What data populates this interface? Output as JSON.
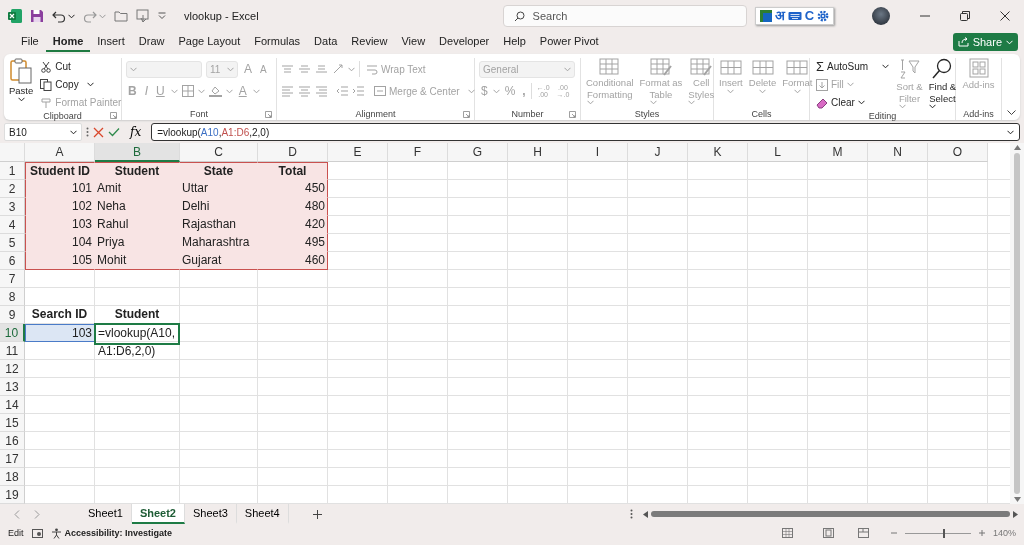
{
  "title_bar": {
    "title": "vlookup  -  Excel",
    "search_placeholder": "Search",
    "language_bar": [
      "अ",
      "C"
    ]
  },
  "menu_tabs": [
    {
      "label": "File",
      "selected": false
    },
    {
      "label": "Home",
      "selected": true
    },
    {
      "label": "Insert",
      "selected": false
    },
    {
      "label": "Draw",
      "selected": false
    },
    {
      "label": "Page Layout",
      "selected": false
    },
    {
      "label": "Formulas",
      "selected": false
    },
    {
      "label": "Data",
      "selected": false
    },
    {
      "label": "Review",
      "selected": false
    },
    {
      "label": "View",
      "selected": false
    },
    {
      "label": "Developer",
      "selected": false
    },
    {
      "label": "Help",
      "selected": false
    },
    {
      "label": "Power Pivot",
      "selected": false
    }
  ],
  "share_button": {
    "label": "Share"
  },
  "ribbon": {
    "clipboard": {
      "label": "Clipboard",
      "paste": {
        "label": "Paste",
        "disabled": false
      },
      "cut": {
        "label": "Cut",
        "disabled": false
      },
      "copy": {
        "label": "Copy",
        "disabled": false
      },
      "format_painter": {
        "label": "Format Painter",
        "disabled": true
      }
    },
    "font": {
      "label": "Font",
      "disabled": true,
      "font_size": "11",
      "grow_font": "A",
      "shrink_font": "A",
      "bold": "B",
      "italic": "I",
      "underline": "U",
      "font_color": "A"
    },
    "alignment": {
      "label": "Alignment",
      "disabled": true,
      "wrap_text": "Wrap Text",
      "merge_center": "Merge & Center"
    },
    "number": {
      "label": "Number",
      "disabled": true,
      "format": "General",
      "currency": "$",
      "percent": "%",
      "comma": ",",
      "decimals": [
        {
          "top": "←.0",
          "bottom": ".00"
        },
        {
          "top": ".00",
          "bottom": "→.0"
        }
      ]
    },
    "styles": {
      "label": "Styles",
      "disabled": true,
      "buttons": [
        {
          "lines": [
            "Conditional",
            "Formatting"
          ]
        },
        {
          "lines": [
            "Format as",
            "Table"
          ]
        },
        {
          "lines": [
            "Cell",
            "Styles"
          ]
        }
      ]
    },
    "cells": {
      "label": "Cells",
      "disabled": true,
      "buttons": [
        "Insert",
        "Delete",
        "Format"
      ]
    },
    "editing": {
      "label": "Editing",
      "autosum": {
        "symbol": "Σ",
        "label": "AutoSum",
        "disabled": false
      },
      "fill": {
        "label": "Fill",
        "disabled": true
      },
      "clear": {
        "label": "Clear",
        "disabled": false
      },
      "sort_filter": {
        "lines": [
          "Sort &",
          "Filter"
        ],
        "disabled": true
      },
      "find_select": {
        "lines": [
          "Find &",
          "Select"
        ],
        "disabled": false
      }
    },
    "addins": {
      "label": "Add-ins",
      "disabled": true,
      "button": "Add-ins"
    }
  },
  "formula_bar": {
    "name_box": "B10",
    "fx": "fx",
    "formula": [
      {
        "text": "=vlookup("
      },
      {
        "text": "A10",
        "color": "#3b6fc4"
      },
      {
        "text": ","
      },
      {
        "text": "A1:D6",
        "color": "#c0504d"
      },
      {
        "text": ",2,0)"
      }
    ]
  },
  "sheet": {
    "columns": [
      {
        "label": "A",
        "selected": false
      },
      {
        "label": "B",
        "selected": true
      },
      {
        "label": "C",
        "selected": false
      },
      {
        "label": "D",
        "selected": false
      },
      {
        "label": "E",
        "selected": false
      },
      {
        "label": "F",
        "selected": false
      },
      {
        "label": "G",
        "selected": false
      },
      {
        "label": "H",
        "selected": false
      },
      {
        "label": "I",
        "selected": false
      },
      {
        "label": "J",
        "selected": false
      },
      {
        "label": "K",
        "selected": false
      },
      {
        "label": "L",
        "selected": false
      },
      {
        "label": "M",
        "selected": false
      },
      {
        "label": "N",
        "selected": false
      },
      {
        "label": "O",
        "selected": false
      }
    ],
    "rows": [
      {
        "number": "1",
        "selected": false,
        "cells": [
          {
            "text": "Student ID",
            "kind": "header",
            "highlighted": true,
            "referenced": false
          },
          {
            "text": "Student",
            "kind": "header",
            "highlighted": true,
            "referenced": false
          },
          {
            "text": "State",
            "kind": "header",
            "highlighted": true,
            "referenced": false
          },
          {
            "text": "Total",
            "kind": "header",
            "highlighted": true,
            "referenced": false
          }
        ]
      },
      {
        "number": "2",
        "selected": false,
        "cells": [
          {
            "text": "101",
            "kind": "number",
            "highlighted": true,
            "referenced": false
          },
          {
            "text": "Amit",
            "kind": "text",
            "highlighted": true,
            "referenced": false
          },
          {
            "text": "Uttar",
            "kind": "text",
            "highlighted": true,
            "referenced": false
          },
          {
            "text": "450",
            "kind": "number",
            "highlighted": true,
            "referenced": false
          }
        ]
      },
      {
        "number": "3",
        "selected": false,
        "cells": [
          {
            "text": "102",
            "kind": "number",
            "highlighted": true,
            "referenced": false
          },
          {
            "text": "Neha",
            "kind": "text",
            "highlighted": true,
            "referenced": false
          },
          {
            "text": "Delhi",
            "kind": "text",
            "highlighted": true,
            "referenced": false
          },
          {
            "text": "480",
            "kind": "number",
            "highlighted": true,
            "referenced": false
          }
        ]
      },
      {
        "number": "4",
        "selected": false,
        "cells": [
          {
            "text": "103",
            "kind": "number",
            "highlighted": true,
            "referenced": false
          },
          {
            "text": "Rahul",
            "kind": "text",
            "highlighted": true,
            "referenced": false
          },
          {
            "text": "Rajasthan",
            "kind": "text",
            "highlighted": true,
            "referenced": false
          },
          {
            "text": "420",
            "kind": "number",
            "highlighted": true,
            "referenced": false
          }
        ]
      },
      {
        "number": "5",
        "selected": false,
        "cells": [
          {
            "text": "104",
            "kind": "number",
            "highlighted": true,
            "referenced": false
          },
          {
            "text": "Priya",
            "kind": "text",
            "highlighted": true,
            "referenced": false
          },
          {
            "text": "Maharashtra",
            "kind": "text",
            "highlighted": true,
            "referenced": false
          },
          {
            "text": "495",
            "kind": "number",
            "highlighted": true,
            "referenced": false
          }
        ]
      },
      {
        "number": "6",
        "selected": false,
        "cells": [
          {
            "text": "105",
            "kind": "number",
            "highlighted": true,
            "referenced": false
          },
          {
            "text": "Mohit",
            "kind": "text",
            "highlighted": true,
            "referenced": false
          },
          {
            "text": "Gujarat",
            "kind": "text",
            "highlighted": true,
            "referenced": false
          },
          {
            "text": "460",
            "kind": "number",
            "highlighted": true,
            "referenced": false
          }
        ]
      },
      {
        "number": "7",
        "selected": false
      },
      {
        "number": "8",
        "selected": false
      },
      {
        "number": "9",
        "selected": false,
        "cells": [
          {
            "text": "Search ID",
            "kind": "header",
            "highlighted": false,
            "referenced": false
          },
          {
            "text": "Student",
            "kind": "header",
            "highlighted": false,
            "referenced": false
          }
        ]
      },
      {
        "number": "10",
        "selected": true,
        "cells": [
          {
            "text": "103",
            "kind": "number",
            "highlighted": false,
            "referenced": true
          },
          {
            "kind": "editor",
            "lines": [
              "=vlookup(A10,",
              "A1:D6,2,0)"
            ]
          }
        ]
      },
      {
        "number": "11",
        "selected": false
      },
      {
        "number": "12",
        "selected": false
      },
      {
        "number": "13",
        "selected": false
      },
      {
        "number": "14",
        "selected": false
      },
      {
        "number": "15",
        "selected": false
      },
      {
        "number": "16",
        "selected": false
      },
      {
        "number": "17",
        "selected": false
      },
      {
        "number": "18",
        "selected": false
      },
      {
        "number": "19",
        "selected": false
      }
    ]
  },
  "sheet_tabs": [
    {
      "label": "Sheet1",
      "selected": false
    },
    {
      "label": "Sheet2",
      "selected": true
    },
    {
      "label": "Sheet3",
      "selected": false
    },
    {
      "label": "Sheet4",
      "selected": false
    }
  ],
  "status_bar": {
    "mode": "Edit",
    "accessibility": "Accessibility: Investigate",
    "zoom": {
      "level": 0.58,
      "label": "140%"
    }
  }
}
